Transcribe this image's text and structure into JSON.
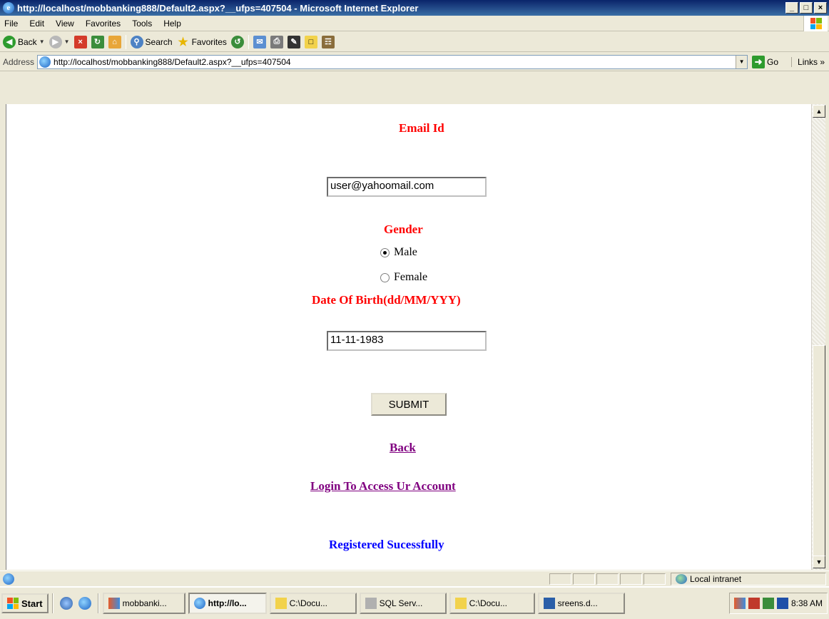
{
  "window": {
    "title": "http://localhost/mobbanking888/Default2.aspx?__ufps=407504 - Microsoft Internet Explorer",
    "min": "_",
    "max": "□",
    "close": "×"
  },
  "menu": {
    "file": "File",
    "edit": "Edit",
    "view": "View",
    "favorites": "Favorites",
    "tools": "Tools",
    "help": "Help"
  },
  "toolbar": {
    "back": "Back",
    "search": "Search",
    "favorites": "Favorites"
  },
  "address": {
    "label": "Address",
    "url": "http://localhost/mobbanking888/Default2.aspx?__ufps=407504",
    "go": "Go",
    "links": "Links »"
  },
  "form": {
    "email_label": "Email Id",
    "email_value": "user@yahoomail.com",
    "gender_label": "Gender",
    "gender_options": [
      "Male",
      "Female"
    ],
    "gender_selected": "Male",
    "dob_label": "Date Of Birth(dd/MM/YYY)",
    "dob_value": "11-11-1983",
    "submit": "SUBMIT",
    "back_link": "Back",
    "login_link": "Login To Access Ur Account",
    "message": "Registered Sucessfully"
  },
  "status": {
    "zone": "Local intranet"
  },
  "taskbar": {
    "start": "Start",
    "tasks": [
      "mobbanki...",
      "http://lo...",
      "C:\\Docu...",
      "SQL Serv...",
      "C:\\Docu...",
      "sreens.d..."
    ],
    "active_task": "http://lo...",
    "clock": "8:38 AM"
  }
}
